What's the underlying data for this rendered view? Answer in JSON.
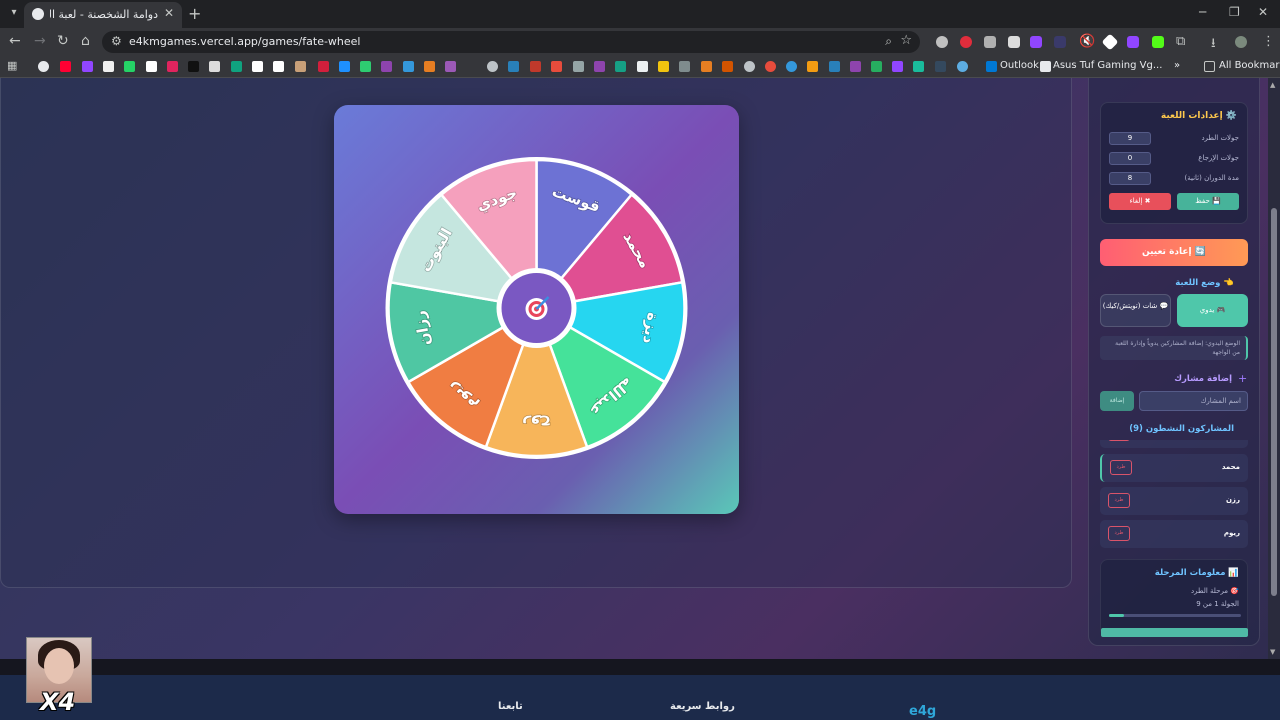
{
  "browser": {
    "tab_title": "دوامة الشخصنة - لعبة العجلة وال",
    "url": "e4kmgames.vercel.app/games/fate-wheel",
    "bookmarks": [
      "Outlook",
      "Asus Tuf Gaming Vg...",
      "All Bookmarks"
    ]
  },
  "wheel": {
    "segments": [
      {
        "label": "قوست",
        "color": "#6d72d4"
      },
      {
        "label": "محمد",
        "color": "#e04f92"
      },
      {
        "label": "ديزة",
        "color": "#26d6f0"
      },
      {
        "label": "عبدالله",
        "color": "#45e29a"
      },
      {
        "label": "روح",
        "color": "#f7b55a"
      },
      {
        "label": "ريوم",
        "color": "#f07d42"
      },
      {
        "label": "رزان",
        "color": "#4fc7a3"
      },
      {
        "label": "البنوت",
        "color": "#c5e6df"
      },
      {
        "label": "جودي",
        "color": "#f5a0bd"
      }
    ],
    "center_icon": "target-icon"
  },
  "settings": {
    "title": "إعدادات اللعبة",
    "rows": [
      {
        "label": "جولات الطرد",
        "value": "9"
      },
      {
        "label": "جولات الإرجاع",
        "value": "0"
      },
      {
        "label": "مدة الدوران (ثانية)",
        "value": "8"
      }
    ],
    "save_label": "💾 حفظ",
    "cancel_label": "✖ إلغاء"
  },
  "reset_label": "🔄 إعادة تعيين",
  "mode": {
    "title": "وضع اللعبة",
    "manual_label": "🎮 يدوي",
    "chat_label": "💬 شات (تويتش/كيك)",
    "description": "الوضع اليدوي: إضافة المشاركين يدوياً وإدارة اللعبة من الواجهة"
  },
  "add": {
    "title": "إضافة مشارك",
    "placeholder": "اسم المشارك",
    "button": "إضافة"
  },
  "participants": {
    "title": "المشاركون النشطون (9)",
    "rows": [
      {
        "name": "محمد",
        "delete": "طرد"
      },
      {
        "name": "رزن",
        "delete": "طرد"
      },
      {
        "name": "ريوم",
        "delete": "طرد"
      }
    ]
  },
  "stage": {
    "title": "📊 معلومات المرحلة",
    "phase": "🎯 مرحلة الطرد",
    "round": "الجولة 1 من 9",
    "progress": 0.11
  },
  "footer": {
    "follow": "تابعنا",
    "quick_links": "روابط سريعة",
    "logo": "e4g"
  },
  "webcam_label": "X4"
}
